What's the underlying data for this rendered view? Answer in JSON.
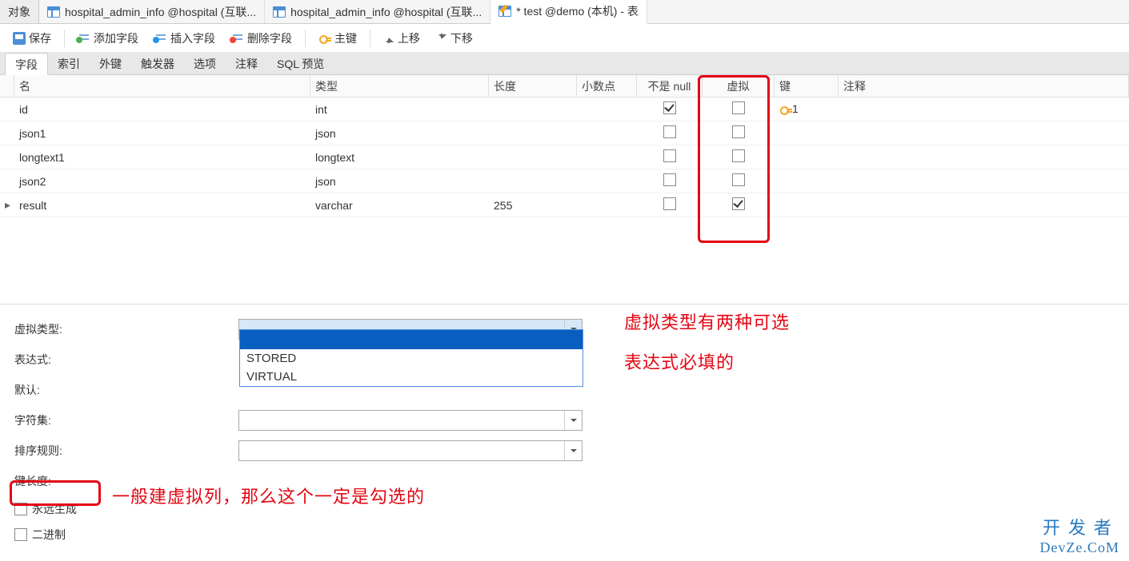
{
  "tabs": {
    "objects": "对象",
    "t1": "hospital_admin_info @hospital (互联...",
    "t2": "hospital_admin_info @hospital (互联...",
    "t3": "* test @demo (本机) - 表"
  },
  "toolbar": {
    "save": "保存",
    "add_field": "添加字段",
    "insert_field": "插入字段",
    "delete_field": "删除字段",
    "primary_key": "主键",
    "move_up": "上移",
    "move_down": "下移"
  },
  "subtabs": {
    "fields": "字段",
    "indexes": "索引",
    "foreign": "外键",
    "triggers": "触发器",
    "options": "选项",
    "comments": "注释",
    "sql_preview": "SQL 预览"
  },
  "columns": {
    "name": "名",
    "type": "类型",
    "length": "长度",
    "decimals": "小数点",
    "notnull": "不是 null",
    "virtual": "虚拟",
    "key": "键",
    "comment": "注释"
  },
  "rows": [
    {
      "name": "id",
      "type": "int",
      "length": "",
      "decimals": "",
      "notnull": true,
      "virtual": false,
      "key": "1",
      "indicator": ""
    },
    {
      "name": "json1",
      "type": "json",
      "length": "",
      "decimals": "",
      "notnull": false,
      "virtual": false,
      "key": "",
      "indicator": ""
    },
    {
      "name": "longtext1",
      "type": "longtext",
      "length": "",
      "decimals": "",
      "notnull": false,
      "virtual": false,
      "key": "",
      "indicator": ""
    },
    {
      "name": "json2",
      "type": "json",
      "length": "",
      "decimals": "",
      "notnull": false,
      "virtual": false,
      "key": "",
      "indicator": ""
    },
    {
      "name": "result",
      "type": "varchar",
      "length": "255",
      "decimals": "",
      "notnull": false,
      "virtual": true,
      "key": "",
      "indicator": "▸"
    }
  ],
  "props": {
    "virtual_type": "虚拟类型:",
    "expression": "表达式:",
    "default": "默认:",
    "charset": "字符集:",
    "collation": "排序规则:",
    "key_length": "键长度:",
    "always_gen": "永远生成",
    "binary": "二进制"
  },
  "dropdown": {
    "opt1": "STORED",
    "opt2": "VIRTUAL"
  },
  "annotations": {
    "right1": "虚拟类型有两种可选",
    "right2": "表达式必填的",
    "bottom": "一般建虚拟列，那么这个一定是勾选的"
  },
  "watermark": {
    "l1": "开发者",
    "l2": "DevZe.CoM"
  }
}
